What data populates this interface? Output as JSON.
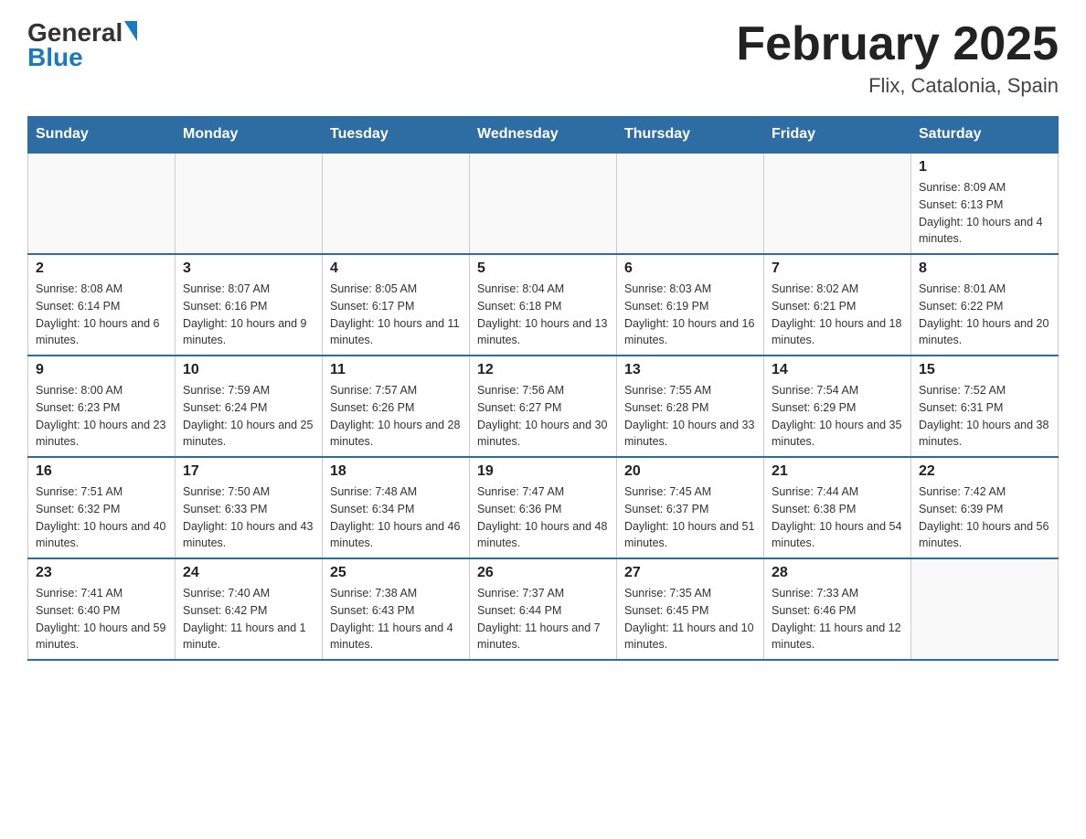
{
  "header": {
    "logo_general": "General",
    "logo_blue": "Blue",
    "month_title": "February 2025",
    "location": "Flix, Catalonia, Spain"
  },
  "days_of_week": [
    "Sunday",
    "Monday",
    "Tuesday",
    "Wednesday",
    "Thursday",
    "Friday",
    "Saturday"
  ],
  "weeks": [
    [
      {
        "day": "",
        "info": ""
      },
      {
        "day": "",
        "info": ""
      },
      {
        "day": "",
        "info": ""
      },
      {
        "day": "",
        "info": ""
      },
      {
        "day": "",
        "info": ""
      },
      {
        "day": "",
        "info": ""
      },
      {
        "day": "1",
        "info": "Sunrise: 8:09 AM\nSunset: 6:13 PM\nDaylight: 10 hours and 4 minutes."
      }
    ],
    [
      {
        "day": "2",
        "info": "Sunrise: 8:08 AM\nSunset: 6:14 PM\nDaylight: 10 hours and 6 minutes."
      },
      {
        "day": "3",
        "info": "Sunrise: 8:07 AM\nSunset: 6:16 PM\nDaylight: 10 hours and 9 minutes."
      },
      {
        "day": "4",
        "info": "Sunrise: 8:05 AM\nSunset: 6:17 PM\nDaylight: 10 hours and 11 minutes."
      },
      {
        "day": "5",
        "info": "Sunrise: 8:04 AM\nSunset: 6:18 PM\nDaylight: 10 hours and 13 minutes."
      },
      {
        "day": "6",
        "info": "Sunrise: 8:03 AM\nSunset: 6:19 PM\nDaylight: 10 hours and 16 minutes."
      },
      {
        "day": "7",
        "info": "Sunrise: 8:02 AM\nSunset: 6:21 PM\nDaylight: 10 hours and 18 minutes."
      },
      {
        "day": "8",
        "info": "Sunrise: 8:01 AM\nSunset: 6:22 PM\nDaylight: 10 hours and 20 minutes."
      }
    ],
    [
      {
        "day": "9",
        "info": "Sunrise: 8:00 AM\nSunset: 6:23 PM\nDaylight: 10 hours and 23 minutes."
      },
      {
        "day": "10",
        "info": "Sunrise: 7:59 AM\nSunset: 6:24 PM\nDaylight: 10 hours and 25 minutes."
      },
      {
        "day": "11",
        "info": "Sunrise: 7:57 AM\nSunset: 6:26 PM\nDaylight: 10 hours and 28 minutes."
      },
      {
        "day": "12",
        "info": "Sunrise: 7:56 AM\nSunset: 6:27 PM\nDaylight: 10 hours and 30 minutes."
      },
      {
        "day": "13",
        "info": "Sunrise: 7:55 AM\nSunset: 6:28 PM\nDaylight: 10 hours and 33 minutes."
      },
      {
        "day": "14",
        "info": "Sunrise: 7:54 AM\nSunset: 6:29 PM\nDaylight: 10 hours and 35 minutes."
      },
      {
        "day": "15",
        "info": "Sunrise: 7:52 AM\nSunset: 6:31 PM\nDaylight: 10 hours and 38 minutes."
      }
    ],
    [
      {
        "day": "16",
        "info": "Sunrise: 7:51 AM\nSunset: 6:32 PM\nDaylight: 10 hours and 40 minutes."
      },
      {
        "day": "17",
        "info": "Sunrise: 7:50 AM\nSunset: 6:33 PM\nDaylight: 10 hours and 43 minutes."
      },
      {
        "day": "18",
        "info": "Sunrise: 7:48 AM\nSunset: 6:34 PM\nDaylight: 10 hours and 46 minutes."
      },
      {
        "day": "19",
        "info": "Sunrise: 7:47 AM\nSunset: 6:36 PM\nDaylight: 10 hours and 48 minutes."
      },
      {
        "day": "20",
        "info": "Sunrise: 7:45 AM\nSunset: 6:37 PM\nDaylight: 10 hours and 51 minutes."
      },
      {
        "day": "21",
        "info": "Sunrise: 7:44 AM\nSunset: 6:38 PM\nDaylight: 10 hours and 54 minutes."
      },
      {
        "day": "22",
        "info": "Sunrise: 7:42 AM\nSunset: 6:39 PM\nDaylight: 10 hours and 56 minutes."
      }
    ],
    [
      {
        "day": "23",
        "info": "Sunrise: 7:41 AM\nSunset: 6:40 PM\nDaylight: 10 hours and 59 minutes."
      },
      {
        "day": "24",
        "info": "Sunrise: 7:40 AM\nSunset: 6:42 PM\nDaylight: 11 hours and 1 minute."
      },
      {
        "day": "25",
        "info": "Sunrise: 7:38 AM\nSunset: 6:43 PM\nDaylight: 11 hours and 4 minutes."
      },
      {
        "day": "26",
        "info": "Sunrise: 7:37 AM\nSunset: 6:44 PM\nDaylight: 11 hours and 7 minutes."
      },
      {
        "day": "27",
        "info": "Sunrise: 7:35 AM\nSunset: 6:45 PM\nDaylight: 11 hours and 10 minutes."
      },
      {
        "day": "28",
        "info": "Sunrise: 7:33 AM\nSunset: 6:46 PM\nDaylight: 11 hours and 12 minutes."
      },
      {
        "day": "",
        "info": ""
      }
    ]
  ]
}
